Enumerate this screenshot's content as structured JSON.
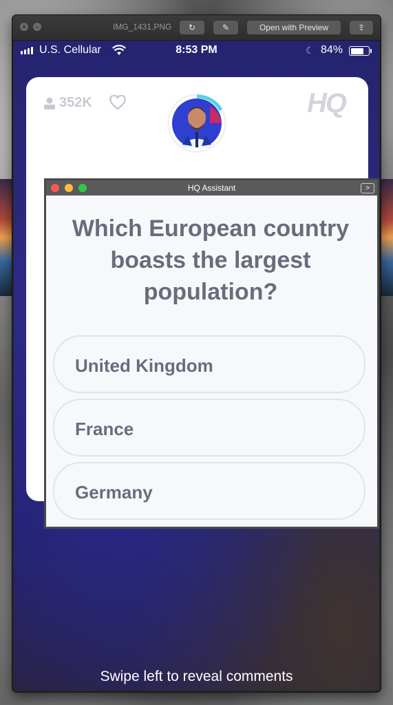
{
  "preview": {
    "filename": "IMG_1431.PNG",
    "open_with_label": "Open with Preview",
    "close_glyph": "×",
    "min_glyph": "–",
    "rotate_glyph": "↻",
    "markup_glyph": "✎",
    "share_glyph": "⇪"
  },
  "status": {
    "carrier": "U.S. Cellular",
    "time": "8:53 PM",
    "battery": "84%",
    "battery_level": 0.84
  },
  "hq": {
    "player_count": "352K",
    "logo": "HQ",
    "accent": "#4fd3e0"
  },
  "assistant": {
    "title": "HQ Assistant",
    "expand": ">",
    "question": "Which European country boasts the largest population?",
    "answers": [
      {
        "label": "United Kingdom"
      },
      {
        "label": "France"
      },
      {
        "label": "Germany"
      }
    ]
  },
  "footer": {
    "swipe_hint": "Swipe left to reveal comments"
  }
}
